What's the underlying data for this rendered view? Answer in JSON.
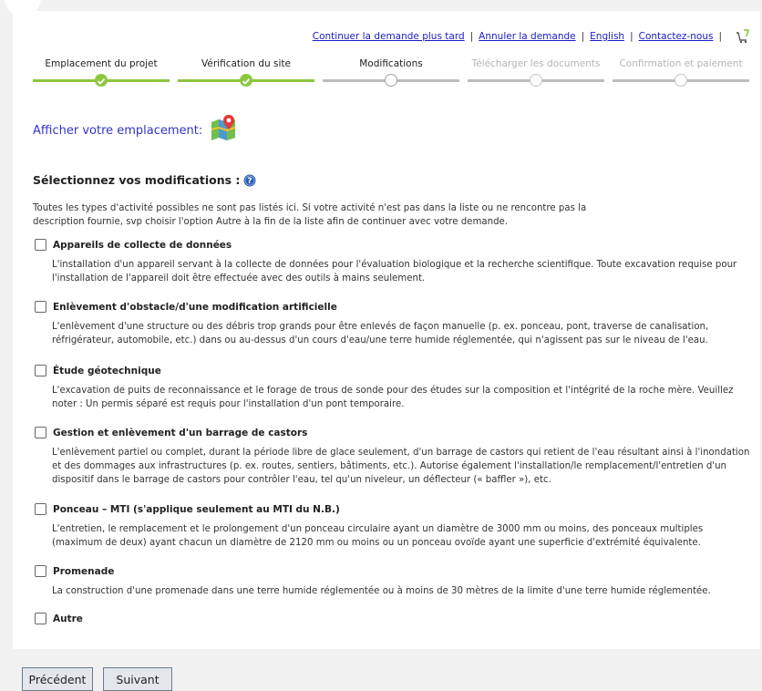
{
  "header": {
    "links": [
      "Continuer la demande plus tard",
      "Annuler la demande",
      "English",
      "Contactez-nous"
    ],
    "cart_icon": "cart-icon"
  },
  "steps": [
    {
      "label": "Emplacement du projet",
      "state": "done"
    },
    {
      "label": "Vérification du site",
      "state": "done"
    },
    {
      "label": "Modifications",
      "state": "current"
    },
    {
      "label": "Télécharger les documents",
      "state": "future"
    },
    {
      "label": "Confirmation et paiement",
      "state": "future"
    }
  ],
  "location": {
    "label": "Afficher votre emplacement:",
    "icon": "map-icon"
  },
  "modifications": {
    "title": "Sélectionnez vos modifications :",
    "intro": "Toutes les types d'activité possibles ne sont pas listés ici. Si votre activité n'est pas dans la liste ou ne rencontre pas la description fournie, svp choisir l'option Autre à la fin de la liste afin de continuer avec votre demande.",
    "options": [
      {
        "title": "Appareils de collecte de données",
        "desc": "L'installation d'un appareil servant à la collecte de données pour l'évaluation biologique et la recherche scientifique. Toute excavation requise pour l'installation de l'appareil doit être effectuée avec des outils à mains seulement.",
        "checked": false
      },
      {
        "title": "Enlèvement d'obstacle/d'une modification artificielle",
        "desc": "L'enlèvement d'une structure ou des débris trop grands pour être enlevés de façon manuelle (p. ex. ponceau, pont, traverse de canalisation, réfrigérateur, automobile, etc.) dans ou au-dessus d'un cours d'eau/une terre humide réglementée, qui n'agissent pas sur le niveau de l'eau.",
        "checked": false
      },
      {
        "title": "Étude géotechnique",
        "desc": "L'excavation de puits de reconnaissance et le forage de trous de sonde pour des études sur la composition et l'intégrité de la roche mère. Veuillez noter : Un permis séparé est requis pour l'installation d'un pont temporaire.",
        "checked": false
      },
      {
        "title": "Gestion et enlèvement d'un barrage de castors",
        "desc": "L'enlèvement partiel ou complet, durant la période libre de glace seulement, d'un barrage de castors qui retient de l'eau résultant ainsi à l'inondation et des dommages aux infrastructures (p. ex. routes, sentiers, bâtiments, etc.). Autorise également l'installation/le remplacement/l'entretien d'un dispositif dans le barrage de castors pour contrôler l'eau, tel qu'un niveleur, un déflecteur (« baffler »), etc.",
        "checked": false
      },
      {
        "title": "Ponceau – MTI (s'applique seulement au MTI du N.B.)",
        "desc": "L'entretien, le remplacement et le prolongement d'un ponceau circulaire ayant un diamètre de 3000 mm ou moins, des ponceaux multiples (maximum de deux) ayant chacun un diamètre de 2120 mm ou moins ou un ponceau ovoïde ayant une superficie d'extrémité équivalente.",
        "checked": false
      },
      {
        "title": "Promenade",
        "desc": "La construction d'une promenade dans une terre humide réglementée ou à moins de 30 mètres de la limite d'une terre humide réglementée.",
        "checked": false
      },
      {
        "title": "Autre",
        "desc": "",
        "checked": false
      }
    ]
  },
  "buttons": {
    "previous": "Précédent",
    "next": "Suivant"
  },
  "colors": {
    "step_done": "#8cc63f",
    "step_pending": "#bdbdbd",
    "link": "#1a1acc",
    "location_label": "#3333cc"
  }
}
